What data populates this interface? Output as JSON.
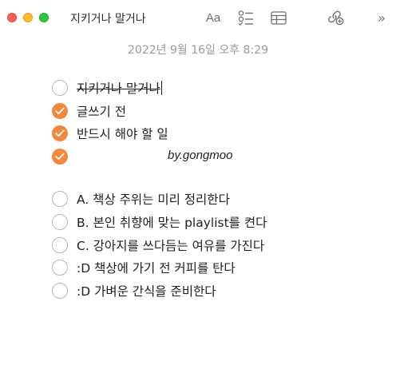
{
  "window": {
    "title": "지키거나 말거나",
    "format_label": "Aa",
    "more_label": "»"
  },
  "note": {
    "datestamp": "2022년 9월 16일 오후 8:29",
    "items": [
      {
        "label": "지키거나 말거나",
        "checked": false
      },
      {
        "label": "글쓰기 전",
        "checked": true
      },
      {
        "label": "반드시 해야 할 일",
        "checked": true
      },
      {
        "label": "",
        "checked": true
      },
      {
        "label": "A. 책상 주위는 미리 정리한다",
        "checked": false
      },
      {
        "label": "B. 본인 취향에 맞는 playlist를 켠다",
        "checked": false
      },
      {
        "label": "C. 강아지를 쓰다듬는 여유를 가진다",
        "checked": false
      },
      {
        "label": ":D 책상에 가기 전 커피를 탄다",
        "checked": false
      },
      {
        "label": ":D 가벼운 간식을 준비한다",
        "checked": false
      }
    ],
    "signature": "by.gongmoo"
  },
  "colors": {
    "accent": "#f5893b",
    "datestamp": "#9a9a9a"
  }
}
